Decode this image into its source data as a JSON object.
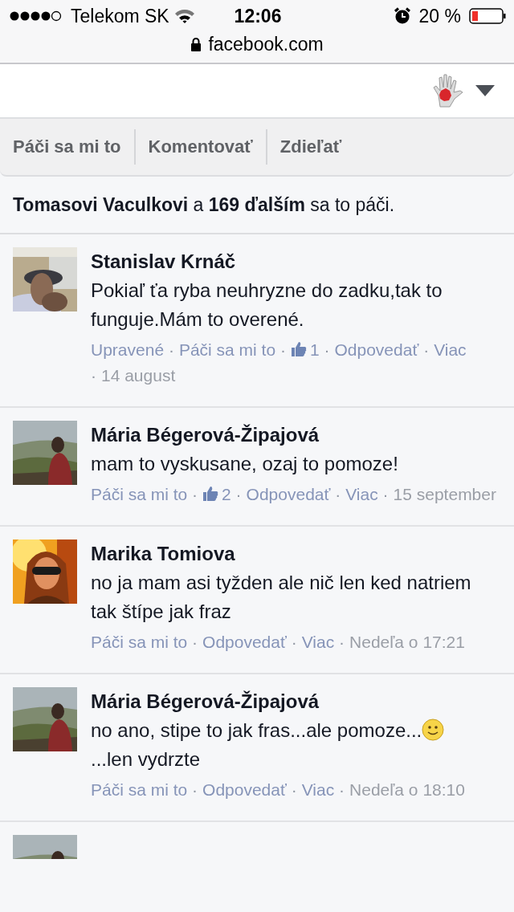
{
  "status_bar": {
    "carrier": "Telekom SK",
    "time": "12:06",
    "battery": "20 %"
  },
  "address_bar": {
    "url": "facebook.com"
  },
  "actions": [
    {
      "label": "Páči sa mi to"
    },
    {
      "label": "Komentovať"
    },
    {
      "label": "Zdieľať"
    }
  ],
  "likes_summary": "**Tomasovi Vaculkovi** a **169 ďalším** sa to páči.",
  "separator": "·",
  "comments": [
    {
      "author": "Stanislav Krnáč",
      "avatar": {
        "kind": "picture"
      },
      "body": [
        {
          "kind": "text",
          "text": "Pokiaľ ťa ryba neuhryzne do zadku,tak to funguje.Mám to overené."
        }
      ],
      "meta": [
        {
          "kind": "edited",
          "text": "Upravené"
        },
        {
          "kind": "like",
          "text": "Páči sa mi to"
        },
        {
          "kind": "likes",
          "text": "1"
        },
        {
          "kind": "reply",
          "text": "Odpovedať"
        },
        {
          "kind": "more",
          "text": "Viac"
        },
        {
          "kind": "time",
          "text": "14 august"
        }
      ]
    },
    {
      "author": "Mária Bégerová-Žipajová",
      "avatar": {
        "kind": "picture"
      },
      "body": [
        {
          "kind": "text",
          "text": "mam to vyskusane, ozaj to pomoze!"
        }
      ],
      "meta": [
        {
          "kind": "like",
          "text": "Páči sa mi to"
        },
        {
          "kind": "likes",
          "text": "2"
        },
        {
          "kind": "reply",
          "text": "Odpovedať"
        },
        {
          "kind": "more",
          "text": "Viac"
        },
        {
          "kind": "time",
          "text": "15 september"
        }
      ]
    },
    {
      "author": "Marika Tomiova",
      "avatar": {
        "kind": "picture"
      },
      "body": [
        {
          "kind": "text",
          "text": "no ja mam asi tyžden ale nič len ked natriem tak štípe jak fraz"
        }
      ],
      "meta": [
        {
          "kind": "like",
          "text": "Páči sa mi to"
        },
        {
          "kind": "reply",
          "text": "Odpovedať"
        },
        {
          "kind": "more",
          "text": "Viac"
        },
        {
          "kind": "time",
          "text": "Nedeľa o 17:21"
        }
      ]
    },
    {
      "author": "Mária Bégerová-Žipajová",
      "avatar": {
        "kind": "picture"
      },
      "body": [
        {
          "kind": "text",
          "text": "no ano, stipe to jak fras...ale pomoze..."
        },
        {
          "kind": "smiley"
        },
        {
          "kind": "text",
          "text": "...len vydrzte"
        }
      ],
      "meta": [
        {
          "kind": "like",
          "text": "Páči sa mi to"
        },
        {
          "kind": "reply",
          "text": "Odpovedať"
        },
        {
          "kind": "more",
          "text": "Viac"
        },
        {
          "kind": "time",
          "text": "Nedeľa o 18:10"
        }
      ]
    },
    {
      "avatar": {
        "kind": "picture"
      }
    }
  ]
}
